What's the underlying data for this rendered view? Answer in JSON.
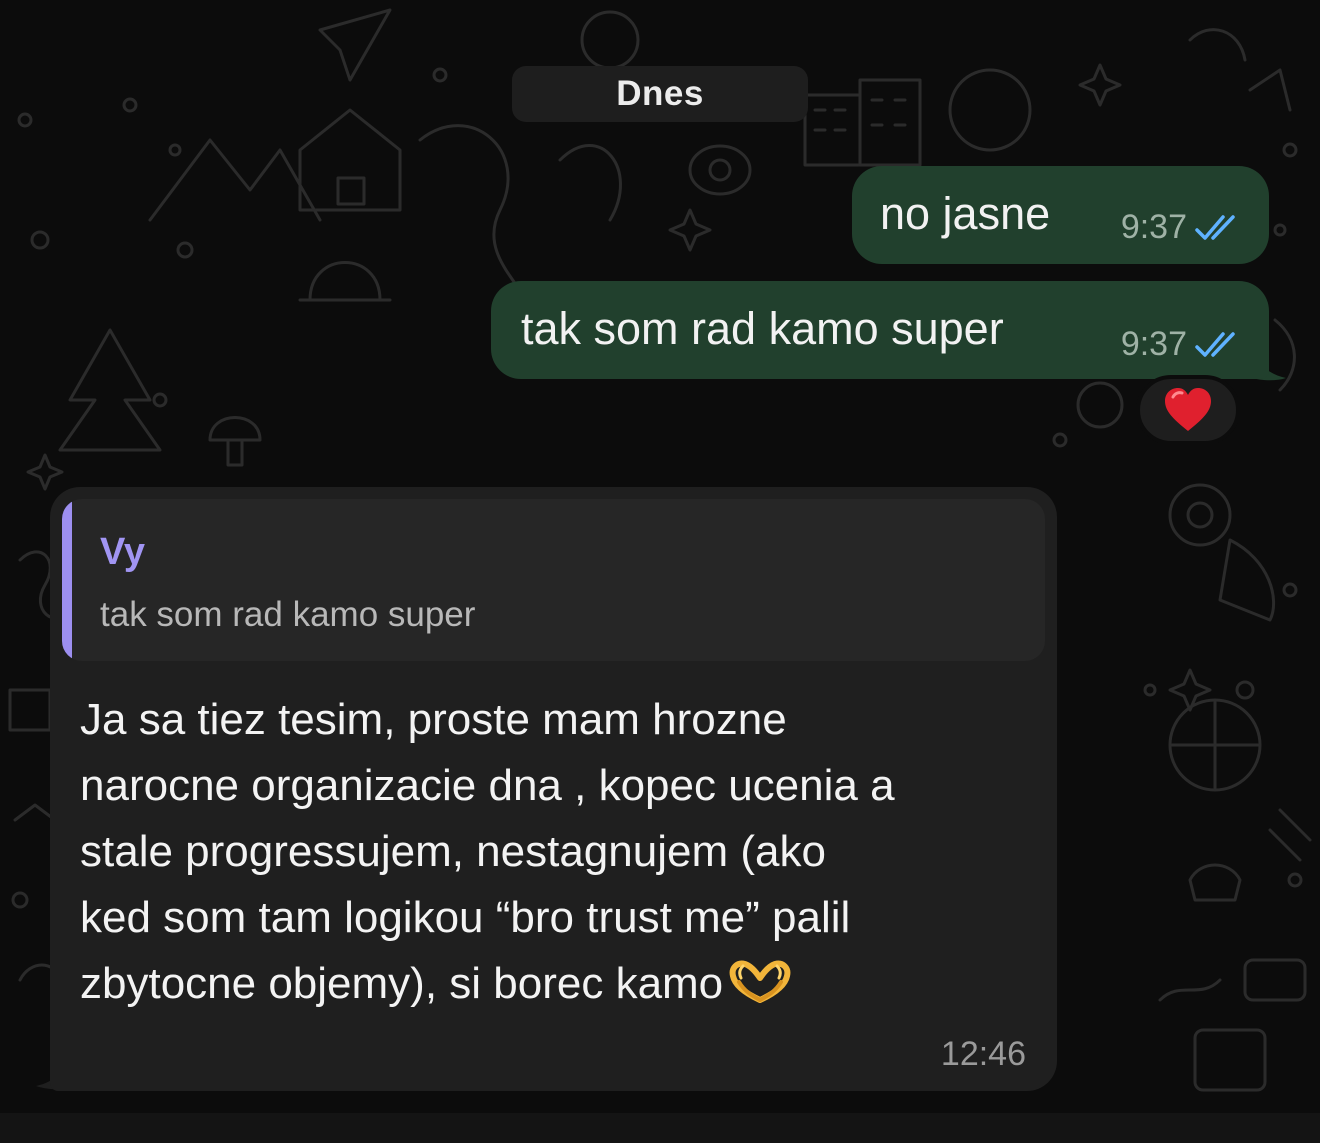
{
  "date_separator": "Dnes",
  "outgoing_messages": [
    {
      "text": "no jasne",
      "time": "9:37",
      "status": "read"
    },
    {
      "text": "tak som rad kamo super",
      "time": "9:37",
      "status": "read",
      "reaction": "red-heart"
    }
  ],
  "incoming_message": {
    "reply_to": {
      "author": "Vy",
      "text": "tak som rad kamo super"
    },
    "lines": [
      "Ja sa tiez tesim, proste mam hrozne",
      "narocne organizacie dna , kopec ucenia a",
      "stale progressujem, nestagnujem (ako",
      "ked som tam logikou “bro trust me” palil",
      "zbytocne objemy), si borec kamo"
    ],
    "trailing_emoji": "heart-hands",
    "time": "12:46"
  },
  "colors": {
    "outgoing_bubble": "#21402d",
    "incoming_bubble": "#1f1f1f",
    "quote_accent": "#9d8ff0",
    "read_ticks": "#5fb2ff",
    "background": "#0c0c0c"
  }
}
